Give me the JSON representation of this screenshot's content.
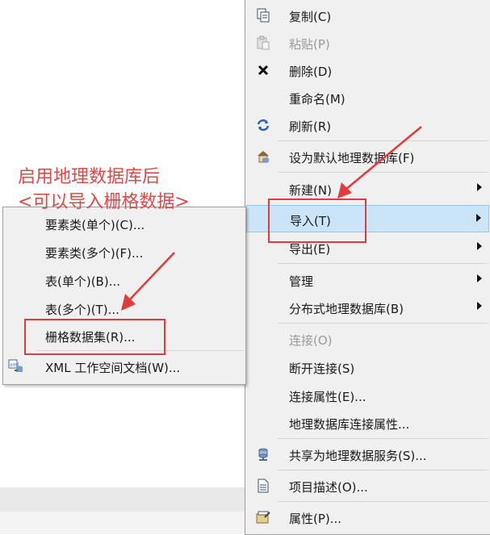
{
  "main_menu": {
    "items": [
      {
        "label": "复制(C)",
        "icon": "copy-icon"
      },
      {
        "label": "粘贴(P)",
        "icon": "paste-icon",
        "disabled": true
      },
      {
        "label": "删除(D)",
        "icon": "delete-icon"
      },
      {
        "label": "重命名(M)"
      },
      {
        "label": "刷新(R)",
        "icon": "refresh-icon"
      },
      {
        "label": "设为默认地理数据库(F)",
        "icon": "home-database-icon"
      },
      {
        "label": "新建(N)",
        "submenu": true
      },
      {
        "label": "导入(T)",
        "submenu": true,
        "highlighted": true
      },
      {
        "label": "导出(E)",
        "submenu": true
      },
      {
        "label": "管理",
        "submenu": true
      },
      {
        "label": "分布式地理数据库(B)",
        "submenu": true
      },
      {
        "label": "连接(O)",
        "disabled": true
      },
      {
        "label": "断开连接(S)"
      },
      {
        "label": "连接属性(E)..."
      },
      {
        "label": "地理数据库连接属性..."
      },
      {
        "label": "共享为地理数据服务(S)...",
        "icon": "share-service-icon"
      },
      {
        "label": "项目描述(O)...",
        "icon": "item-description-icon"
      },
      {
        "label": "属性(P)...",
        "icon": "properties-icon"
      }
    ]
  },
  "import_submenu": {
    "items": [
      {
        "label": "要素类(单个)(C)..."
      },
      {
        "label": "要素类(多个)(F)..."
      },
      {
        "label": "表(单个)(B)..."
      },
      {
        "label": "表(多个)(T)..."
      },
      {
        "label": "栅格数据集(R)..."
      },
      {
        "label": "XML 工作空间文档(W)...",
        "icon": "xml-workspace-icon"
      }
    ]
  },
  "annotation": {
    "line1": "启用地理数据库后",
    "line2": "<可以导入栅格数据>",
    "color": "#e34848"
  },
  "colors": {
    "highlight": "#cce4f7",
    "menu_bg": "#f0f0f0",
    "annotation_red": "#e23b3b"
  }
}
